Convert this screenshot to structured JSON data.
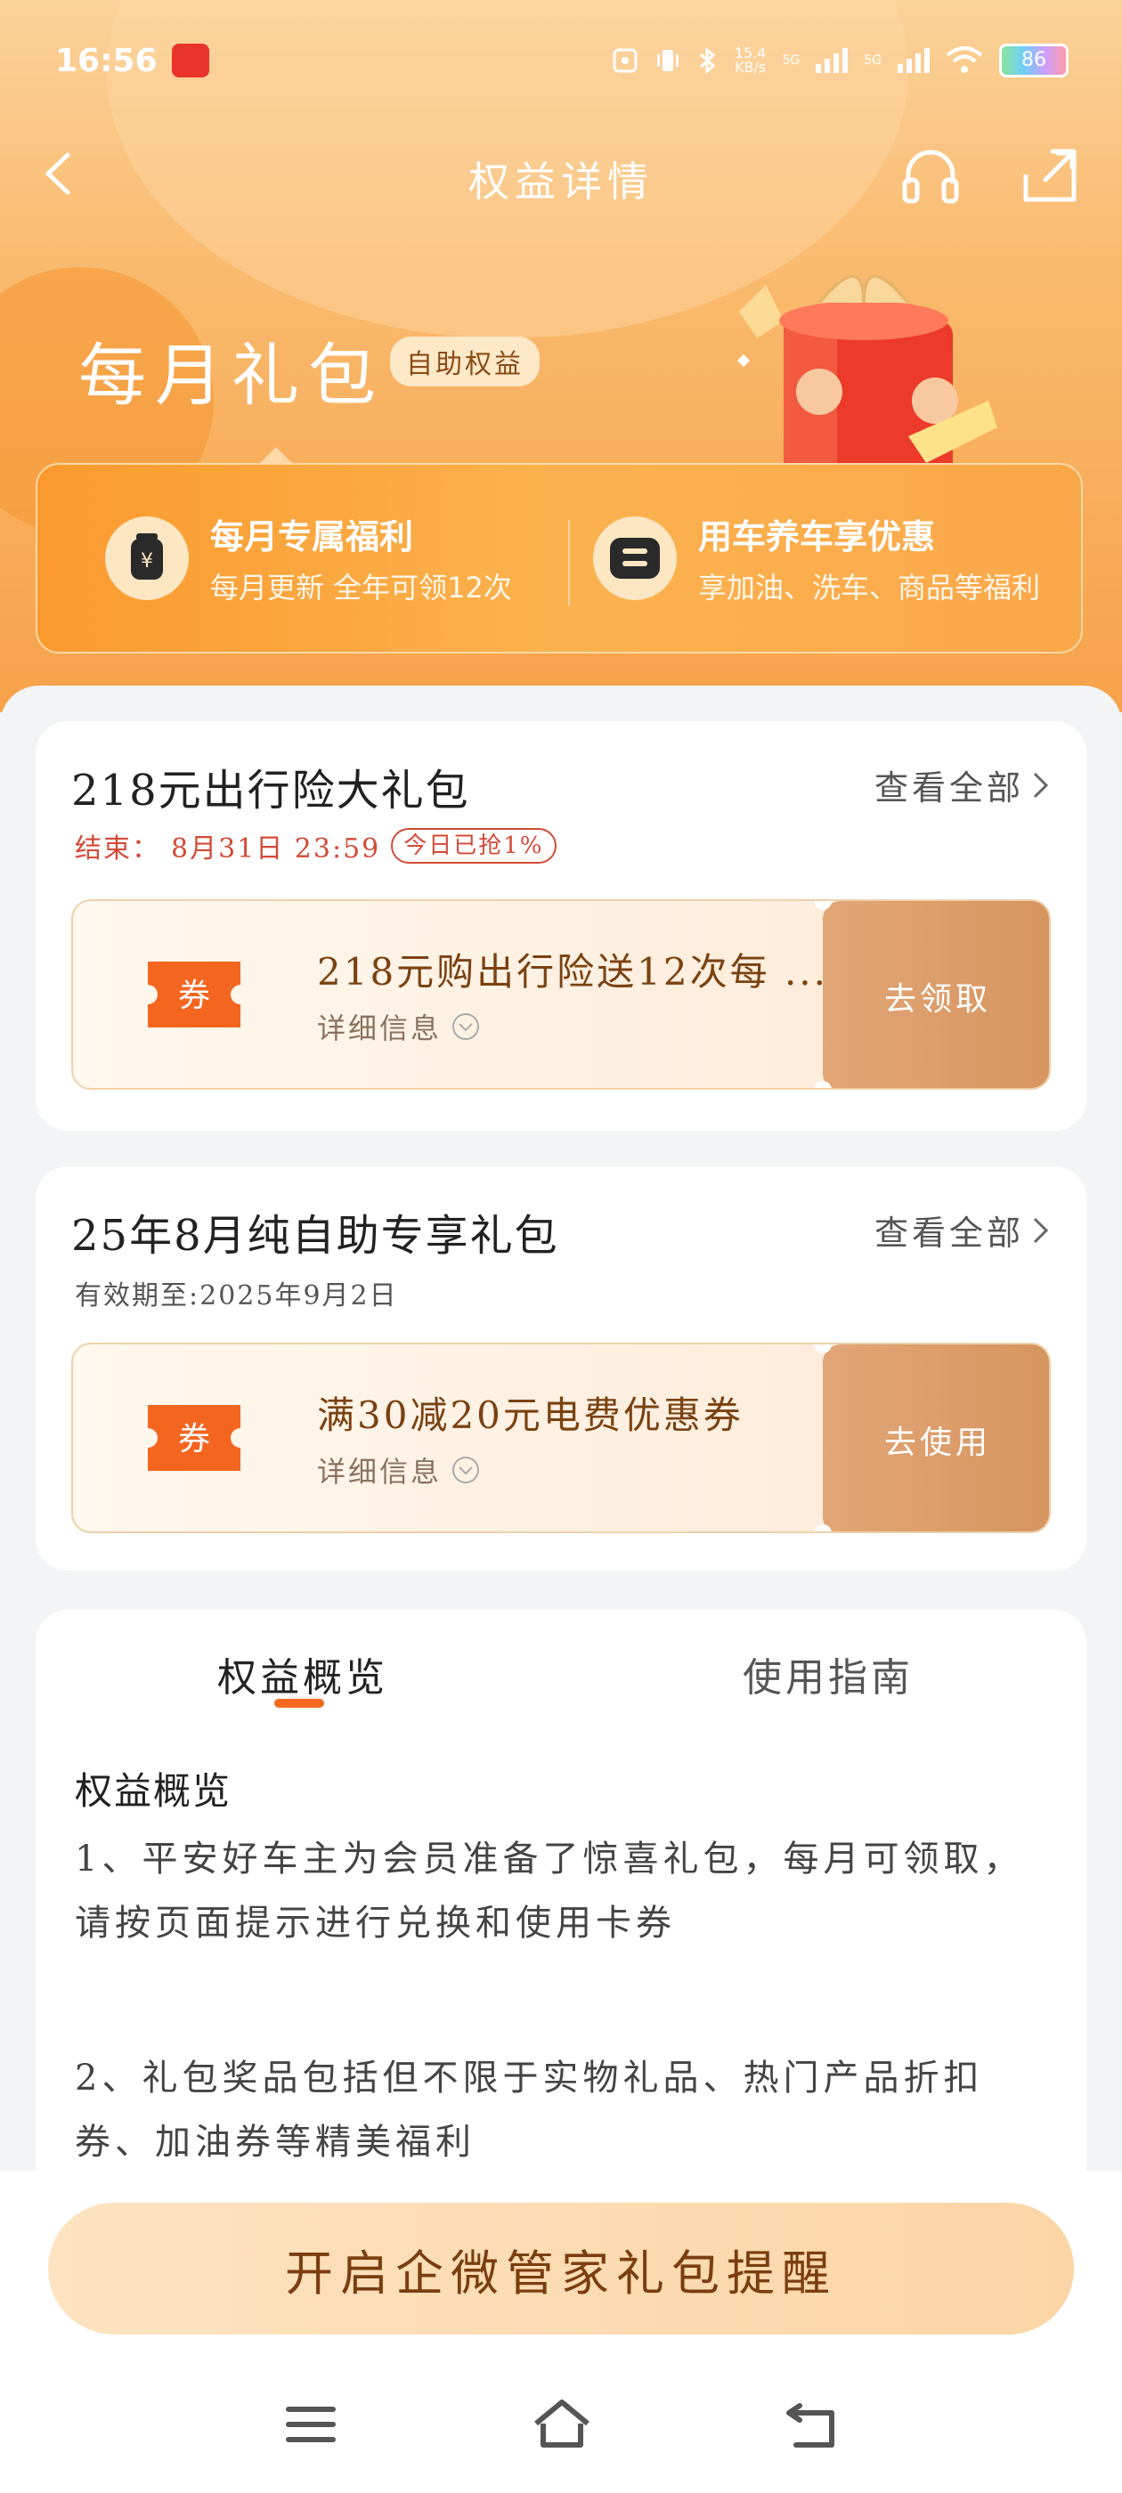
{
  "status_bar": {
    "time": "16:56",
    "net_speed": "15.4\nKB/s",
    "signal_1": "5G",
    "signal_2": "5G",
    "battery": "86"
  },
  "header": {
    "title": "权益详情"
  },
  "package": {
    "title": "每月礼包",
    "tag": "自助权益"
  },
  "benefits": [
    {
      "title": "每月专属福利",
      "desc": "每月更新 全年可领12次",
      "icon": "coin-jar-icon"
    },
    {
      "title": "用车养车享优惠",
      "desc": "享加油、洗车、商品等福利",
      "icon": "ticket-icon"
    }
  ],
  "card1": {
    "title": "218元出行险大礼包",
    "see_all": "查看全部",
    "end_label": "结束：",
    "end_time": "8月31日 23:59",
    "progress": "今日已抢1%",
    "coupon": {
      "badge": "券",
      "text": "218元购出行险送12次每 ...",
      "details": "详细信息",
      "action": "去领取"
    }
  },
  "card2": {
    "title": "25年8月纯自助专享礼包",
    "see_all": "查看全部",
    "validity": "有效期至:2025年9月2日",
    "coupon": {
      "badge": "券",
      "text": "满30减20元电费优惠券",
      "details": "详细信息",
      "action": "去使用"
    }
  },
  "info": {
    "tabs": [
      "权益概览",
      "使用指南"
    ],
    "heading": "权益概览",
    "paragraphs": [
      "1、平安好车主为会员准备了惊喜礼包，每月可领取，请按页面提示进行兑换和使用卡券",
      "2、礼包奖品包括但不限于实物礼品、热门产品折扣券、加油券等精美福利"
    ]
  },
  "cta": {
    "label": "开启企微管家礼包提醒"
  },
  "colors": {
    "accent": "#f56a1e",
    "hero": "#f7a24a",
    "coupon_action": "#d6955f"
  }
}
